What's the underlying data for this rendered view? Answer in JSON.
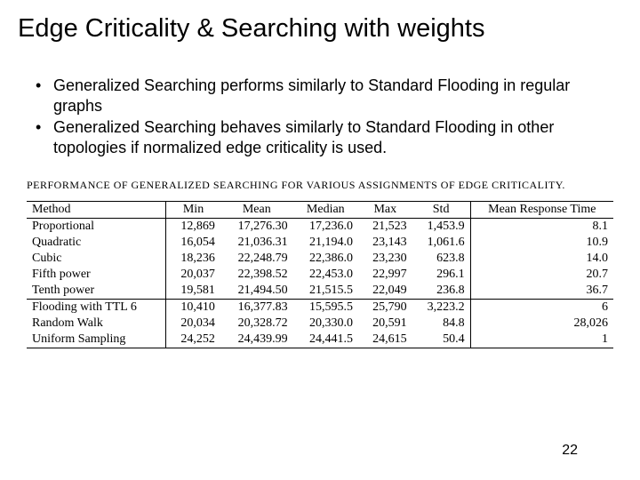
{
  "title": "Edge Criticality & Searching with weights",
  "bullets": [
    "Generalized Searching performs similarly to Standard Flooding in regular graphs",
    "Generalized Searching behaves similarly to Standard Flooding in other topologies if normalized edge criticality is used."
  ],
  "table": {
    "caption": "PERFORMANCE OF GENERALIZED SEARCHING FOR VARIOUS ASSIGNMENTS OF EDGE CRITICALITY.",
    "headers": [
      "Method",
      "Min",
      "Mean",
      "Median",
      "Max",
      "Std",
      "Mean Response Time"
    ],
    "rows_group1": [
      {
        "method": "Proportional",
        "min": "12,869",
        "mean": "17,276.30",
        "median": "17,236.0",
        "max": "21,523",
        "std": "1,453.9",
        "mrt": "8.1"
      },
      {
        "method": "Quadratic",
        "min": "16,054",
        "mean": "21,036.31",
        "median": "21,194.0",
        "max": "23,143",
        "std": "1,061.6",
        "mrt": "10.9"
      },
      {
        "method": "Cubic",
        "min": "18,236",
        "mean": "22,248.79",
        "median": "22,386.0",
        "max": "23,230",
        "std": "623.8",
        "mrt": "14.0"
      },
      {
        "method": "Fifth power",
        "min": "20,037",
        "mean": "22,398.52",
        "median": "22,453.0",
        "max": "22,997",
        "std": "296.1",
        "mrt": "20.7"
      },
      {
        "method": "Tenth power",
        "min": "19,581",
        "mean": "21,494.50",
        "median": "21,515.5",
        "max": "22,049",
        "std": "236.8",
        "mrt": "36.7"
      }
    ],
    "rows_group2": [
      {
        "method": "Flooding with TTL 6",
        "min": "10,410",
        "mean": "16,377.83",
        "median": "15,595.5",
        "max": "25,790",
        "std": "3,223.2",
        "mrt": "6"
      },
      {
        "method": "Random Walk",
        "min": "20,034",
        "mean": "20,328.72",
        "median": "20,330.0",
        "max": "20,591",
        "std": "84.8",
        "mrt": "28,026"
      },
      {
        "method": "Uniform Sampling",
        "min": "24,252",
        "mean": "24,439.99",
        "median": "24,441.5",
        "max": "24,615",
        "std": "50.4",
        "mrt": "1"
      }
    ]
  },
  "page_number": "22"
}
